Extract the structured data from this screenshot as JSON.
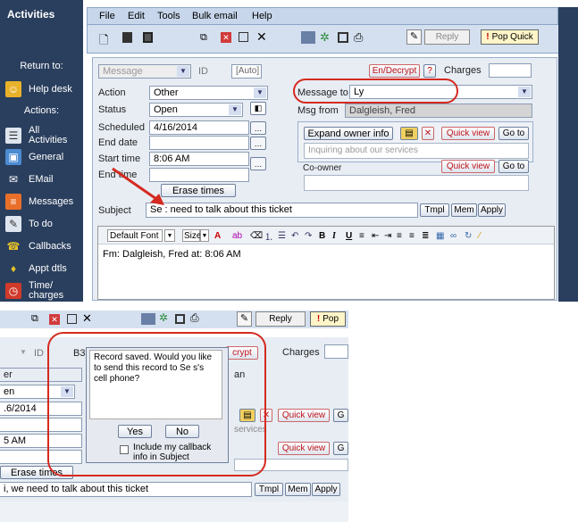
{
  "sidebar": {
    "title": "Activities",
    "return_to": "Return to:",
    "help_desk": "Help desk",
    "actions": "Actions:",
    "items": [
      {
        "label": "All Activities",
        "icon": "list-icon"
      },
      {
        "label": "General",
        "icon": "general-icon"
      },
      {
        "label": "EMail",
        "icon": "email-icon"
      },
      {
        "label": "Messages",
        "icon": "messages-icon"
      },
      {
        "label": "To do",
        "icon": "todo-icon"
      },
      {
        "label": "Callbacks",
        "icon": "callbacks-icon"
      },
      {
        "label": "Appt dtls",
        "icon": "appointment-icon"
      },
      {
        "label": "Time/ charges",
        "icon": "clock-icon"
      }
    ]
  },
  "menu": [
    "File",
    "Edit",
    "Tools",
    "Bulk email",
    "Help"
  ],
  "toolbar": {
    "reply": "Reply",
    "pop_quick": "Pop Quick"
  },
  "form": {
    "type_value": "Message",
    "id_label": "ID",
    "id_value": "[Auto]",
    "en_decrypt": "En/Decrypt",
    "help": "?",
    "charges_label": "Charges",
    "action_label": "Action",
    "action_value": "Other",
    "status_label": "Status",
    "status_value": "Open",
    "scheduled_label": "Scheduled",
    "scheduled_value": "4/16/2014",
    "end_date_label": "End date",
    "start_time_label": "Start time",
    "start_time_value": "8:06 AM",
    "end_time_label": "End time",
    "erase_times": "Erase times",
    "message_to_label": "Message to",
    "message_to_value": "Ly",
    "msg_from_label": "Msg from",
    "msg_from_value": "Dalgleish, Fred",
    "expand_owner": "Expand owner info",
    "quick_view": "Quick view",
    "go_to": "Go to",
    "owner_note": "Inquiring about our services",
    "co_owner_label": "Co-owner",
    "subject_label": "Subject",
    "subject_value": "Se          : need to talk about this ticket",
    "tmpl": "Tmpl",
    "mem": "Mem",
    "apply": "Apply"
  },
  "editor": {
    "font": "Default Font",
    "size": "Size",
    "body": "Fm: Dalgleish, Fred at: 8:06 AM"
  },
  "bottom": {
    "reply": "Reply",
    "pop": "Pop",
    "id_label": "ID",
    "id_value": "B31",
    "decrypt": "crypt",
    "charges_label": "Charges",
    "row1": "er",
    "row2": "en",
    "row3": ".6/2014",
    "row4": "5 AM",
    "erase_times": "Erase times",
    "subject": "i, we need to talk about this ticket",
    "an": "an",
    "services": "services",
    "quick_view": "Quick view",
    "go": "G",
    "tmpl": "Tmpl",
    "mem": "Mem",
    "apply": "Apply"
  },
  "popup": {
    "message": "Record saved. Would you like to send this record to Se          s's cell phone?",
    "yes": "Yes",
    "no": "No",
    "include": "Include my callback info in Subject"
  }
}
